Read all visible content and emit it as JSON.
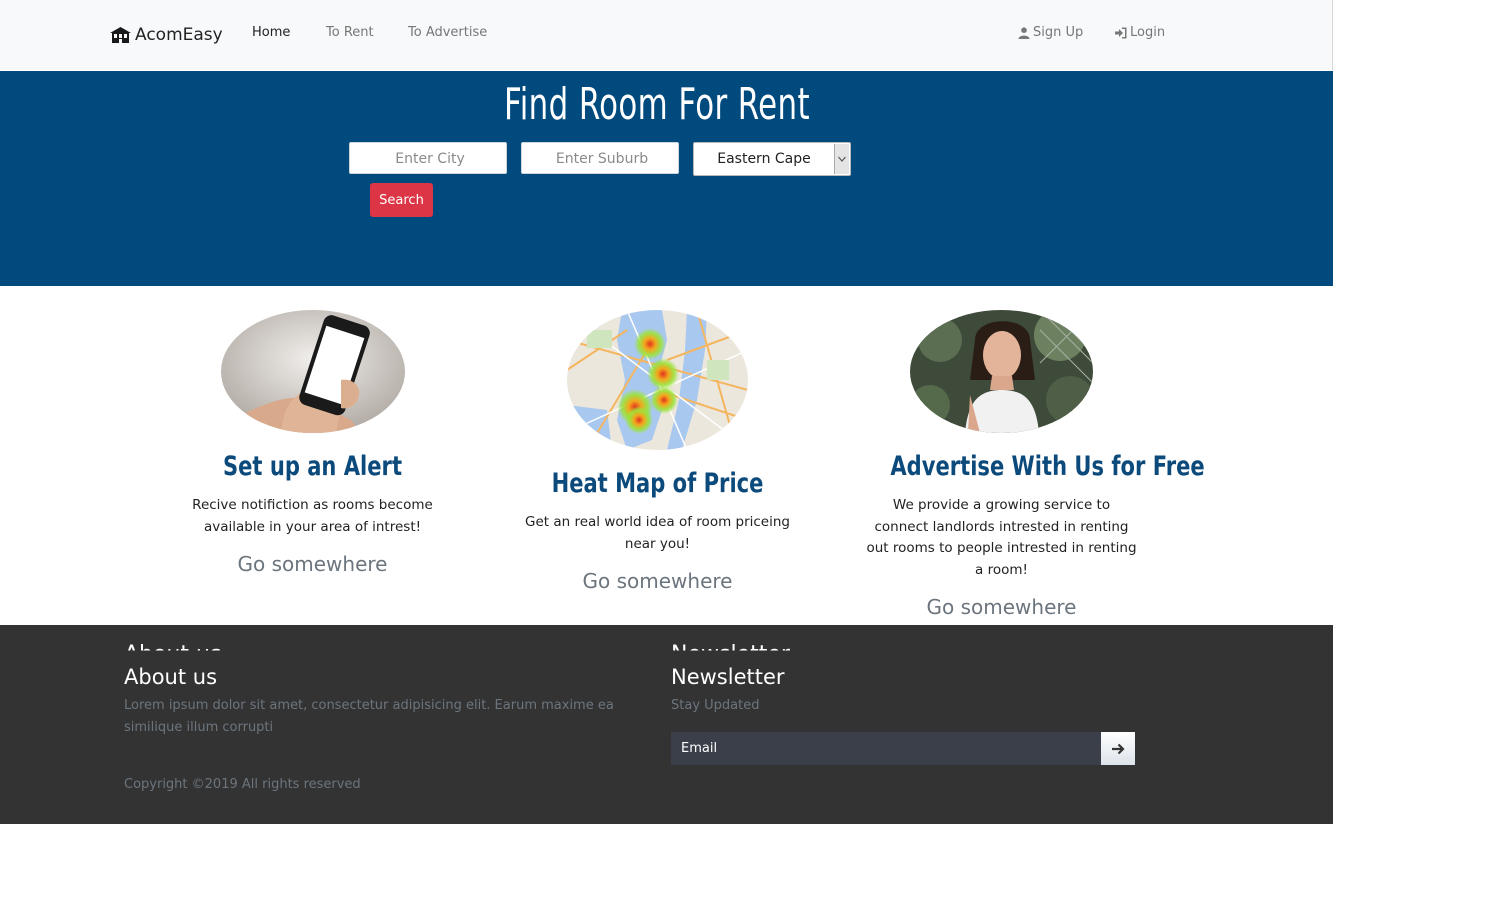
{
  "nav": {
    "brand": "AcomEasy",
    "links": [
      "Home",
      "To Rent",
      "To Advertise"
    ],
    "signup": "Sign Up",
    "login": "Login"
  },
  "hero": {
    "title": "Find Room For Rent",
    "city_placeholder": "Enter City",
    "suburb_placeholder": "Enter Suburb",
    "province_selected": "Eastern Cape",
    "search_label": "Search"
  },
  "features": [
    {
      "title": "Set up an Alert",
      "text": "Recive notifiction as rooms become available in your area of intrest!",
      "link": "Go somewhere"
    },
    {
      "title": "Heat Map of Price",
      "text": "Get an real world idea of room priceing near you!",
      "link": "Go somewhere"
    },
    {
      "title": "Advertise With Us for Free",
      "text": "We provide a growing service to connect landlords intrested in renting out rooms to people intrested in renting a room!",
      "link": "Go somewhere"
    }
  ],
  "footer": {
    "about_title": "About us",
    "about_text": "Lorem ipsum dolor sit amet, consectetur adipisicing elit. Earum maxime ea similique illum corrupti",
    "copyright": "Copyright ©2019 All rights reserved",
    "newsletter_title": "Newsletter",
    "newsletter_text": "Stay Updated",
    "email_placeholder": "Email"
  },
  "colors": {
    "hero_bg": "#004a7e",
    "accent_red": "#dc3545",
    "heading_blue": "#0c4a7c",
    "footer_bg": "#333333"
  }
}
